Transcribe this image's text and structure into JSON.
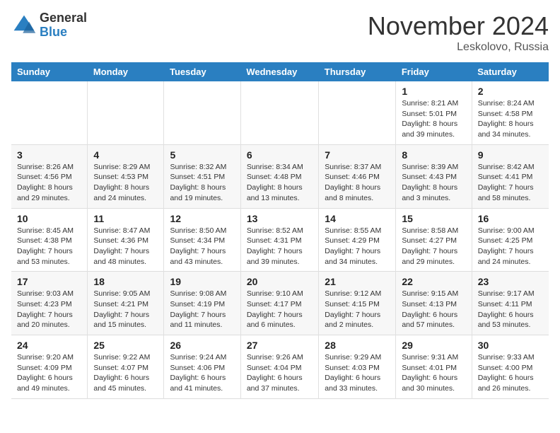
{
  "header": {
    "logo_line1": "General",
    "logo_line2": "Blue",
    "month_title": "November 2024",
    "location": "Leskolovo, Russia"
  },
  "weekdays": [
    "Sunday",
    "Monday",
    "Tuesday",
    "Wednesday",
    "Thursday",
    "Friday",
    "Saturday"
  ],
  "weeks": [
    [
      {
        "day": "",
        "detail": ""
      },
      {
        "day": "",
        "detail": ""
      },
      {
        "day": "",
        "detail": ""
      },
      {
        "day": "",
        "detail": ""
      },
      {
        "day": "",
        "detail": ""
      },
      {
        "day": "1",
        "detail": "Sunrise: 8:21 AM\nSunset: 5:01 PM\nDaylight: 8 hours and 39 minutes."
      },
      {
        "day": "2",
        "detail": "Sunrise: 8:24 AM\nSunset: 4:58 PM\nDaylight: 8 hours and 34 minutes."
      }
    ],
    [
      {
        "day": "3",
        "detail": "Sunrise: 8:26 AM\nSunset: 4:56 PM\nDaylight: 8 hours and 29 minutes."
      },
      {
        "day": "4",
        "detail": "Sunrise: 8:29 AM\nSunset: 4:53 PM\nDaylight: 8 hours and 24 minutes."
      },
      {
        "day": "5",
        "detail": "Sunrise: 8:32 AM\nSunset: 4:51 PM\nDaylight: 8 hours and 19 minutes."
      },
      {
        "day": "6",
        "detail": "Sunrise: 8:34 AM\nSunset: 4:48 PM\nDaylight: 8 hours and 13 minutes."
      },
      {
        "day": "7",
        "detail": "Sunrise: 8:37 AM\nSunset: 4:46 PM\nDaylight: 8 hours and 8 minutes."
      },
      {
        "day": "8",
        "detail": "Sunrise: 8:39 AM\nSunset: 4:43 PM\nDaylight: 8 hours and 3 minutes."
      },
      {
        "day": "9",
        "detail": "Sunrise: 8:42 AM\nSunset: 4:41 PM\nDaylight: 7 hours and 58 minutes."
      }
    ],
    [
      {
        "day": "10",
        "detail": "Sunrise: 8:45 AM\nSunset: 4:38 PM\nDaylight: 7 hours and 53 minutes."
      },
      {
        "day": "11",
        "detail": "Sunrise: 8:47 AM\nSunset: 4:36 PM\nDaylight: 7 hours and 48 minutes."
      },
      {
        "day": "12",
        "detail": "Sunrise: 8:50 AM\nSunset: 4:34 PM\nDaylight: 7 hours and 43 minutes."
      },
      {
        "day": "13",
        "detail": "Sunrise: 8:52 AM\nSunset: 4:31 PM\nDaylight: 7 hours and 39 minutes."
      },
      {
        "day": "14",
        "detail": "Sunrise: 8:55 AM\nSunset: 4:29 PM\nDaylight: 7 hours and 34 minutes."
      },
      {
        "day": "15",
        "detail": "Sunrise: 8:58 AM\nSunset: 4:27 PM\nDaylight: 7 hours and 29 minutes."
      },
      {
        "day": "16",
        "detail": "Sunrise: 9:00 AM\nSunset: 4:25 PM\nDaylight: 7 hours and 24 minutes."
      }
    ],
    [
      {
        "day": "17",
        "detail": "Sunrise: 9:03 AM\nSunset: 4:23 PM\nDaylight: 7 hours and 20 minutes."
      },
      {
        "day": "18",
        "detail": "Sunrise: 9:05 AM\nSunset: 4:21 PM\nDaylight: 7 hours and 15 minutes."
      },
      {
        "day": "19",
        "detail": "Sunrise: 9:08 AM\nSunset: 4:19 PM\nDaylight: 7 hours and 11 minutes."
      },
      {
        "day": "20",
        "detail": "Sunrise: 9:10 AM\nSunset: 4:17 PM\nDaylight: 7 hours and 6 minutes."
      },
      {
        "day": "21",
        "detail": "Sunrise: 9:12 AM\nSunset: 4:15 PM\nDaylight: 7 hours and 2 minutes."
      },
      {
        "day": "22",
        "detail": "Sunrise: 9:15 AM\nSunset: 4:13 PM\nDaylight: 6 hours and 57 minutes."
      },
      {
        "day": "23",
        "detail": "Sunrise: 9:17 AM\nSunset: 4:11 PM\nDaylight: 6 hours and 53 minutes."
      }
    ],
    [
      {
        "day": "24",
        "detail": "Sunrise: 9:20 AM\nSunset: 4:09 PM\nDaylight: 6 hours and 49 minutes."
      },
      {
        "day": "25",
        "detail": "Sunrise: 9:22 AM\nSunset: 4:07 PM\nDaylight: 6 hours and 45 minutes."
      },
      {
        "day": "26",
        "detail": "Sunrise: 9:24 AM\nSunset: 4:06 PM\nDaylight: 6 hours and 41 minutes."
      },
      {
        "day": "27",
        "detail": "Sunrise: 9:26 AM\nSunset: 4:04 PM\nDaylight: 6 hours and 37 minutes."
      },
      {
        "day": "28",
        "detail": "Sunrise: 9:29 AM\nSunset: 4:03 PM\nDaylight: 6 hours and 33 minutes."
      },
      {
        "day": "29",
        "detail": "Sunrise: 9:31 AM\nSunset: 4:01 PM\nDaylight: 6 hours and 30 minutes."
      },
      {
        "day": "30",
        "detail": "Sunrise: 9:33 AM\nSunset: 4:00 PM\nDaylight: 6 hours and 26 minutes."
      }
    ]
  ]
}
